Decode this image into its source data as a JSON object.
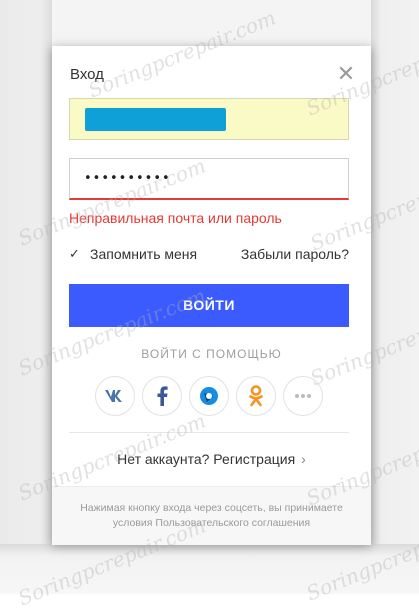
{
  "dialog": {
    "title": "Вход",
    "close_symbol": "✕",
    "password_mask": "••••••••••",
    "error": "Неправильная почта или пароль",
    "remember_label": "Запомнить меня",
    "remember_checked": true,
    "forgot_label": "Забыли пароль?",
    "login_button": "ВОЙТИ",
    "social_caption": "ВОЙТИ С ПОМОЩЬЮ",
    "social_buttons": [
      {
        "name": "vk-icon",
        "color": "#4a76a8"
      },
      {
        "name": "facebook-icon",
        "color": "#3b5998"
      },
      {
        "name": "mailru-icon",
        "color": "#168de2"
      },
      {
        "name": "odnoklassniki-icon",
        "color": "#f7931e"
      },
      {
        "name": "more-icon",
        "color": "#bbbbbb"
      }
    ],
    "register_text": "Нет аккаунта? Регистрация",
    "footer_text": "Нажимая кнопку входа через соцсеть, вы принимаете условия Пользовательского соглашения"
  },
  "colors": {
    "login_button": "#3b5bff",
    "error": "#e53935",
    "autofill": "#fafac7"
  },
  "watermark": "Soringpcrepair.com"
}
